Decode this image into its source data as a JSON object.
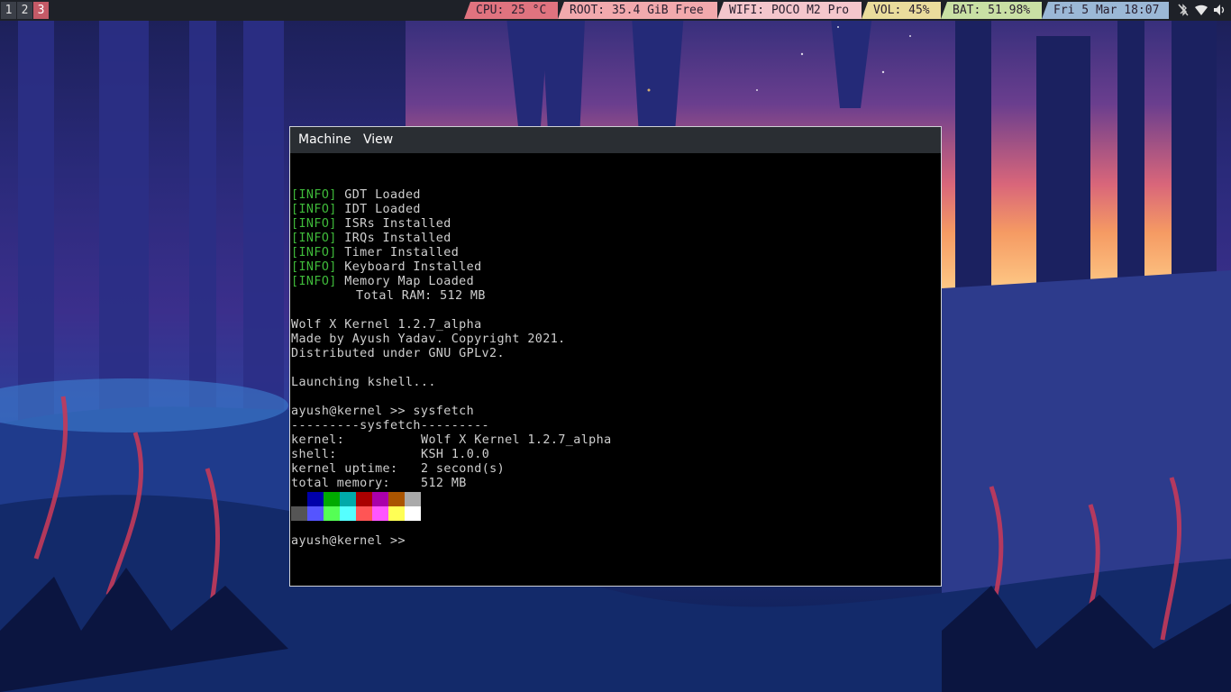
{
  "topbar": {
    "workspaces": [
      "1",
      "2",
      "3"
    ],
    "active_workspace": "3",
    "cpu": "CPU: 25 °C",
    "root": "ROOT: 35.4 GiB Free",
    "wifi": "WIFI: POCO M2 Pro",
    "vol": "VOL: 45%",
    "bat": "BAT: 51.98%",
    "date": "Fri 5 Mar 18:07",
    "tray_icons": [
      "bluetooth-off-icon",
      "wifi-icon",
      "volume-icon"
    ],
    "colors": {
      "cpu": "#e0737f",
      "root": "#f2a9ad",
      "wifi": "#f4c6cc",
      "vol": "#eadc9c",
      "bat": "#c9e0a4",
      "date": "#9bb8d6"
    }
  },
  "vm": {
    "menu": [
      "Machine",
      "View"
    ],
    "info_tag": "[INFO]",
    "boot": [
      "GDT Loaded",
      "IDT Loaded",
      "ISRs Installed",
      "IRQs Installed",
      "Timer Installed",
      "Keyboard Installed",
      "Memory Map Loaded"
    ],
    "ram": "Total RAM: 512 MB",
    "banner": [
      "Wolf X Kernel 1.2.7_alpha",
      "Made by Ayush Yadav. Copyright 2021.",
      "Distributed under GNU GPLv2."
    ],
    "launching": "Launching kshell...",
    "prompt_cmd": "ayush@kernel >> sysfetch",
    "separator": "---------sysfetch---------",
    "sysfetch": [
      {
        "key": "kernel:",
        "value": "Wolf X Kernel 1.2.7_alpha"
      },
      {
        "key": "shell:",
        "value": "KSH 1.0.0"
      },
      {
        "key": "kernel uptime:",
        "value": "2 second(s)"
      },
      {
        "key": "total memory:",
        "value": "512 MB"
      }
    ],
    "palette_dark": [
      "#000000",
      "#0000aa",
      "#00aa00",
      "#00aaaa",
      "#aa0000",
      "#aa00aa",
      "#aa5500",
      "#aaaaaa"
    ],
    "palette_bright": [
      "#555555",
      "#5555ff",
      "#55ff55",
      "#55ffff",
      "#ff5555",
      "#ff55ff",
      "#ffff55",
      "#ffffff"
    ],
    "prompt": "ayush@kernel >>"
  }
}
